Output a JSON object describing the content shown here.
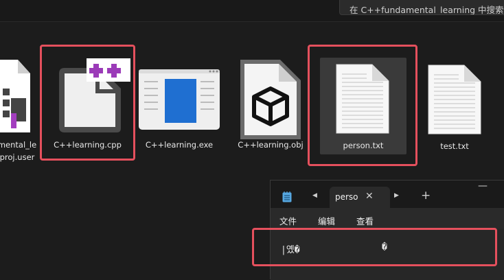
{
  "search": {
    "text": "在 C++fundamental_learning 中搜索"
  },
  "files": [
    {
      "name_line1": "mental_le",
      "name_line2": "proj.user",
      "icon": "vcxproj-user-file-icon"
    },
    {
      "name": "C++learning.cpp",
      "icon": "cpp-file-icon"
    },
    {
      "name": "C++learning.exe",
      "icon": "exe-window-icon"
    },
    {
      "name": "C++learning.obj",
      "icon": "obj-cube-icon"
    },
    {
      "name": "person.txt",
      "icon": "text-file-icon"
    },
    {
      "name": "test.txt",
      "icon": "text-file-icon"
    }
  ],
  "notepad": {
    "tab_label": "perso",
    "menus": [
      "文件",
      "编辑",
      "查看"
    ],
    "content_left": "|옜�",
    "content_right": "�"
  },
  "colors": {
    "highlight": "#e5505d",
    "cpp_accent": "#9b3bb8",
    "exe_blue": "#1f6fd1"
  }
}
